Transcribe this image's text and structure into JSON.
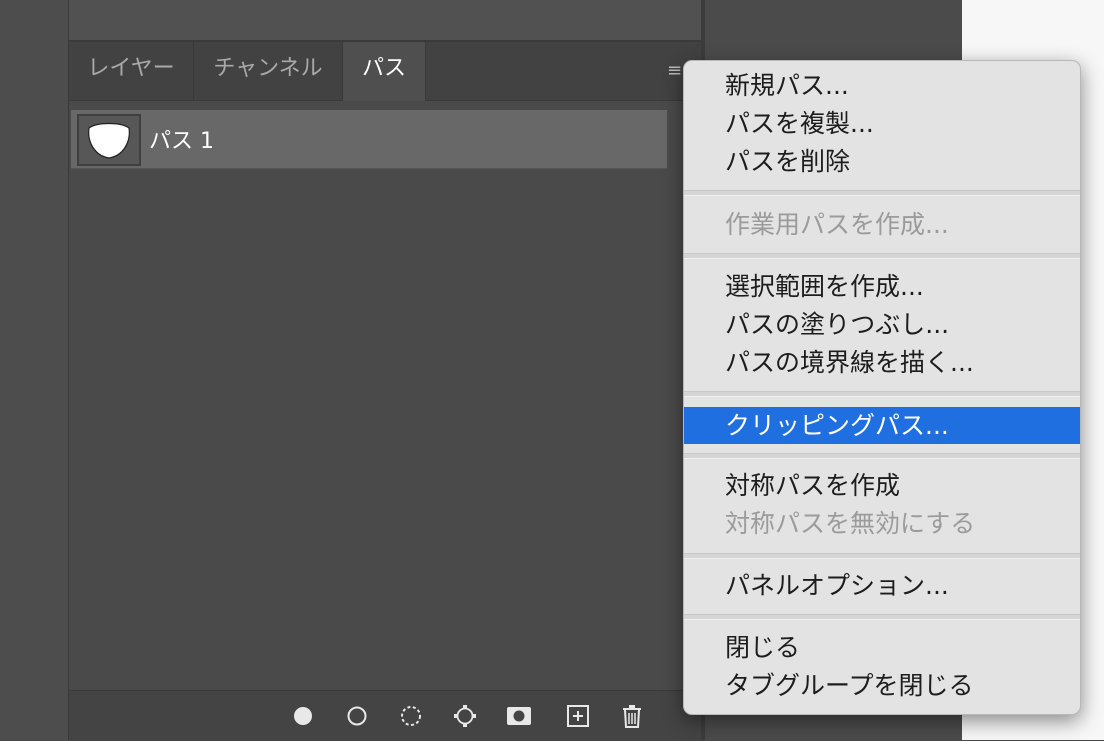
{
  "tabs": [
    {
      "label": "レイヤー"
    },
    {
      "label": "チャンネル"
    },
    {
      "label": "パス"
    }
  ],
  "active_tab": "パス",
  "paths": [
    {
      "name": "パス 1"
    }
  ],
  "panel_menu_icon": "hamburger-icon",
  "bottom_tools": [
    {
      "icon": "fill-path-icon"
    },
    {
      "icon": "stroke-path-icon"
    },
    {
      "icon": "load-selection-icon"
    },
    {
      "icon": "make-path-from-selection-icon"
    },
    {
      "icon": "add-mask-icon"
    },
    {
      "icon": "new-path-icon"
    },
    {
      "icon": "delete-path-icon"
    }
  ],
  "menu": {
    "groups": [
      [
        {
          "label": "新規パス...",
          "enabled": true
        },
        {
          "label": "パスを複製...",
          "enabled": true
        },
        {
          "label": "パスを削除",
          "enabled": true
        }
      ],
      [
        {
          "label": "作業用パスを作成...",
          "enabled": false
        }
      ],
      [
        {
          "label": "選択範囲を作成...",
          "enabled": true
        },
        {
          "label": "パスの塗りつぶし...",
          "enabled": true
        },
        {
          "label": "パスの境界線を描く...",
          "enabled": true
        }
      ],
      [
        {
          "label": "クリッピングパス...",
          "enabled": true,
          "highlighted": true
        }
      ],
      [
        {
          "label": "対称パスを作成",
          "enabled": true
        },
        {
          "label": "対称パスを無効にする",
          "enabled": false
        }
      ],
      [
        {
          "label": "パネルオプション...",
          "enabled": true
        }
      ],
      [
        {
          "label": "閉じる",
          "enabled": true
        },
        {
          "label": "タブグループを閉じる",
          "enabled": true
        }
      ]
    ]
  },
  "colors": {
    "highlight": "#1f6fe0",
    "panel_bg": "#4a4a4a",
    "menu_bg": "#e3e3e3"
  }
}
